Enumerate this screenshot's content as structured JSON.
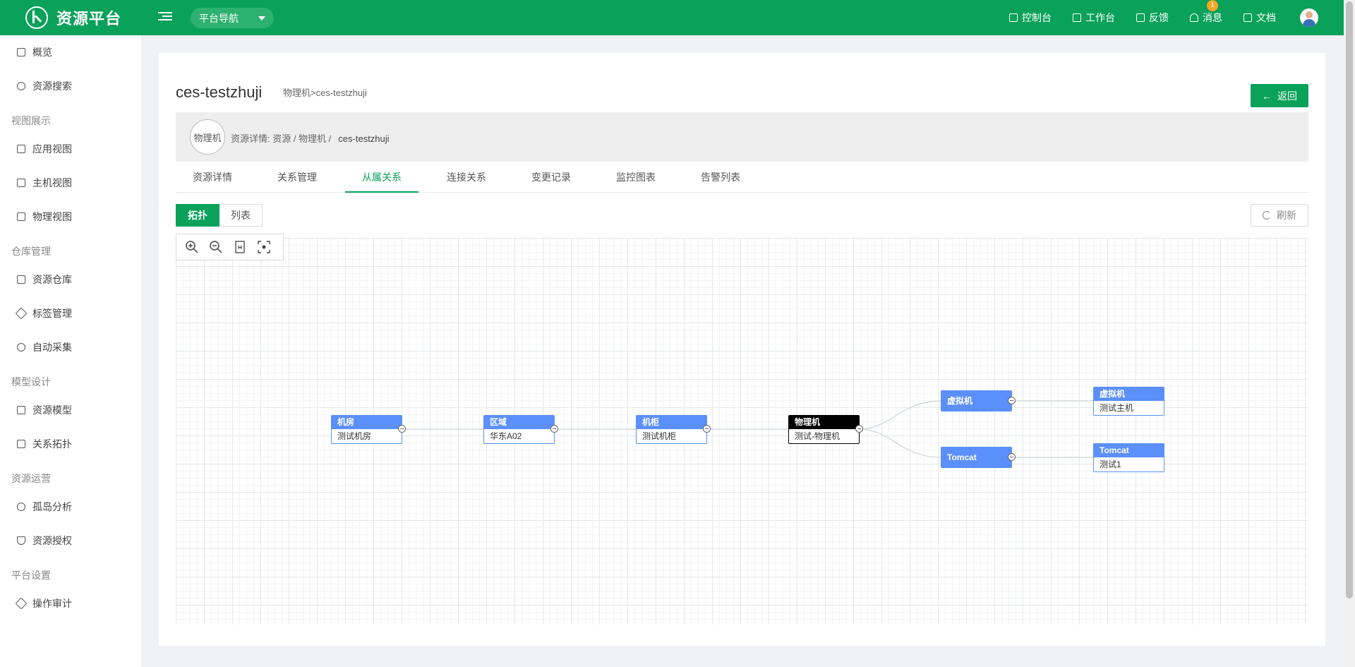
{
  "header": {
    "brand": "资源平台",
    "platform_nav": "平台导航",
    "actions": [
      {
        "label": "控制台",
        "icon": "monitor-icon"
      },
      {
        "label": "工作台",
        "icon": "home-icon"
      },
      {
        "label": "反馈",
        "icon": "feedback-icon"
      },
      {
        "label": "消息",
        "icon": "bell-icon",
        "badge": "1"
      },
      {
        "label": "文档",
        "icon": "document-icon"
      }
    ]
  },
  "sidebar": {
    "items": [
      {
        "label": "概览",
        "icon": "home-icon"
      },
      {
        "label": "资源搜索",
        "icon": "search-icon"
      },
      {
        "label": "应用视图",
        "icon": "app-view-icon"
      },
      {
        "label": "主机视图",
        "icon": "host-view-icon"
      },
      {
        "label": "物理视图",
        "icon": "physical-view-icon"
      },
      {
        "label": "资源仓库",
        "icon": "repository-icon"
      },
      {
        "label": "标签管理",
        "icon": "tag-icon"
      },
      {
        "label": "自动采集",
        "icon": "auto-collect-icon"
      },
      {
        "label": "资源模型",
        "icon": "model-icon"
      },
      {
        "label": "关系拓扑",
        "icon": "topology-icon"
      },
      {
        "label": "孤岛分析",
        "icon": "pie-icon"
      },
      {
        "label": "资源授权",
        "icon": "shield-icon"
      },
      {
        "label": "操作审计",
        "icon": "audit-icon"
      }
    ],
    "groups": [
      "视图展示",
      "仓库管理",
      "模型设计",
      "资源运营",
      "平台设置"
    ]
  },
  "page": {
    "title": "ces-testzhuji",
    "subtitle": "物理机>ces-testzhuji",
    "back_label": "返回",
    "badge_circle": "物理机",
    "breadcrumb_prefix": "资源详情:  资源 / 物理机 /",
    "breadcrumb_current": "ces-testzhuji",
    "tabs": [
      "资源详情",
      "关系管理",
      "从属关系",
      "连接关系",
      "变更记录",
      "监控图表",
      "告警列表"
    ],
    "active_tab": "从属关系",
    "view_modes": [
      "拓扑",
      "列表"
    ],
    "active_view": "拓扑",
    "refresh_label": "刷新"
  },
  "topology": {
    "nodes": [
      {
        "id": "room",
        "type": "机房",
        "name": "测试机房"
      },
      {
        "id": "region",
        "type": "区域",
        "name": "华东A02"
      },
      {
        "id": "rack",
        "type": "机柜",
        "name": "测试机柜"
      },
      {
        "id": "server",
        "type": "物理机",
        "name": "测试-物理机",
        "current": true
      },
      {
        "id": "vmgroup",
        "type": "虚拟机",
        "name": ""
      },
      {
        "id": "tomcatgroup",
        "type": "Tomcat",
        "name": ""
      },
      {
        "id": "vm1",
        "type": "虚拟机",
        "name": "测试主机"
      },
      {
        "id": "tomcat1",
        "type": "Tomcat",
        "name": "测试1"
      }
    ],
    "edges": [
      [
        "room",
        "region"
      ],
      [
        "region",
        "rack"
      ],
      [
        "rack",
        "server"
      ],
      [
        "server",
        "vmgroup"
      ],
      [
        "server",
        "tomcatgroup"
      ],
      [
        "vmgroup",
        "vm1"
      ],
      [
        "tomcatgroup",
        "tomcat1"
      ]
    ],
    "colors": {
      "node": "#5b8ff9",
      "current": "#000000",
      "link": "#cfd3d8"
    }
  },
  "theme": {
    "primary": "#0aa15a"
  }
}
